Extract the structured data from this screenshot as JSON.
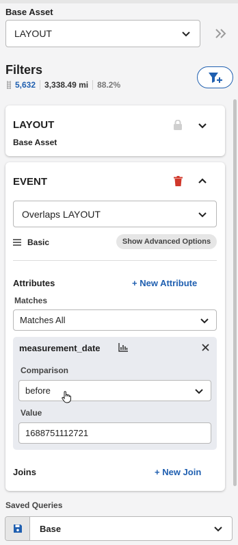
{
  "base_asset": {
    "label": "Base Asset",
    "selected": "LAYOUT"
  },
  "filters": {
    "title": "Filters",
    "stats": {
      "count": "5,632",
      "distance": "3,338.49 mi",
      "percent": "88.2%"
    }
  },
  "cards": {
    "layout": {
      "title": "LAYOUT",
      "subtitle": "Base Asset"
    },
    "event": {
      "title": "EVENT",
      "relation_selected": "Overlaps LAYOUT",
      "mode_label": "Basic",
      "advanced_button": "Show Advanced Options",
      "attributes_title": "Attributes",
      "new_attribute": "+ New Attribute",
      "matches_label": "Matches",
      "matches_selected": "Matches All",
      "attribute": {
        "name": "measurement_date",
        "comparison_label": "Comparison",
        "comparison_selected": "before",
        "value_label": "Value",
        "value": "1688751112721"
      },
      "joins_title": "Joins",
      "new_join": "+ New Join"
    }
  },
  "saved_queries": {
    "label": "Saved Queries",
    "selected": "Base"
  },
  "colors": {
    "accent_blue": "#1f5fb0",
    "delete_red": "#d0382b",
    "panel_bg": "#f4f4f5"
  }
}
